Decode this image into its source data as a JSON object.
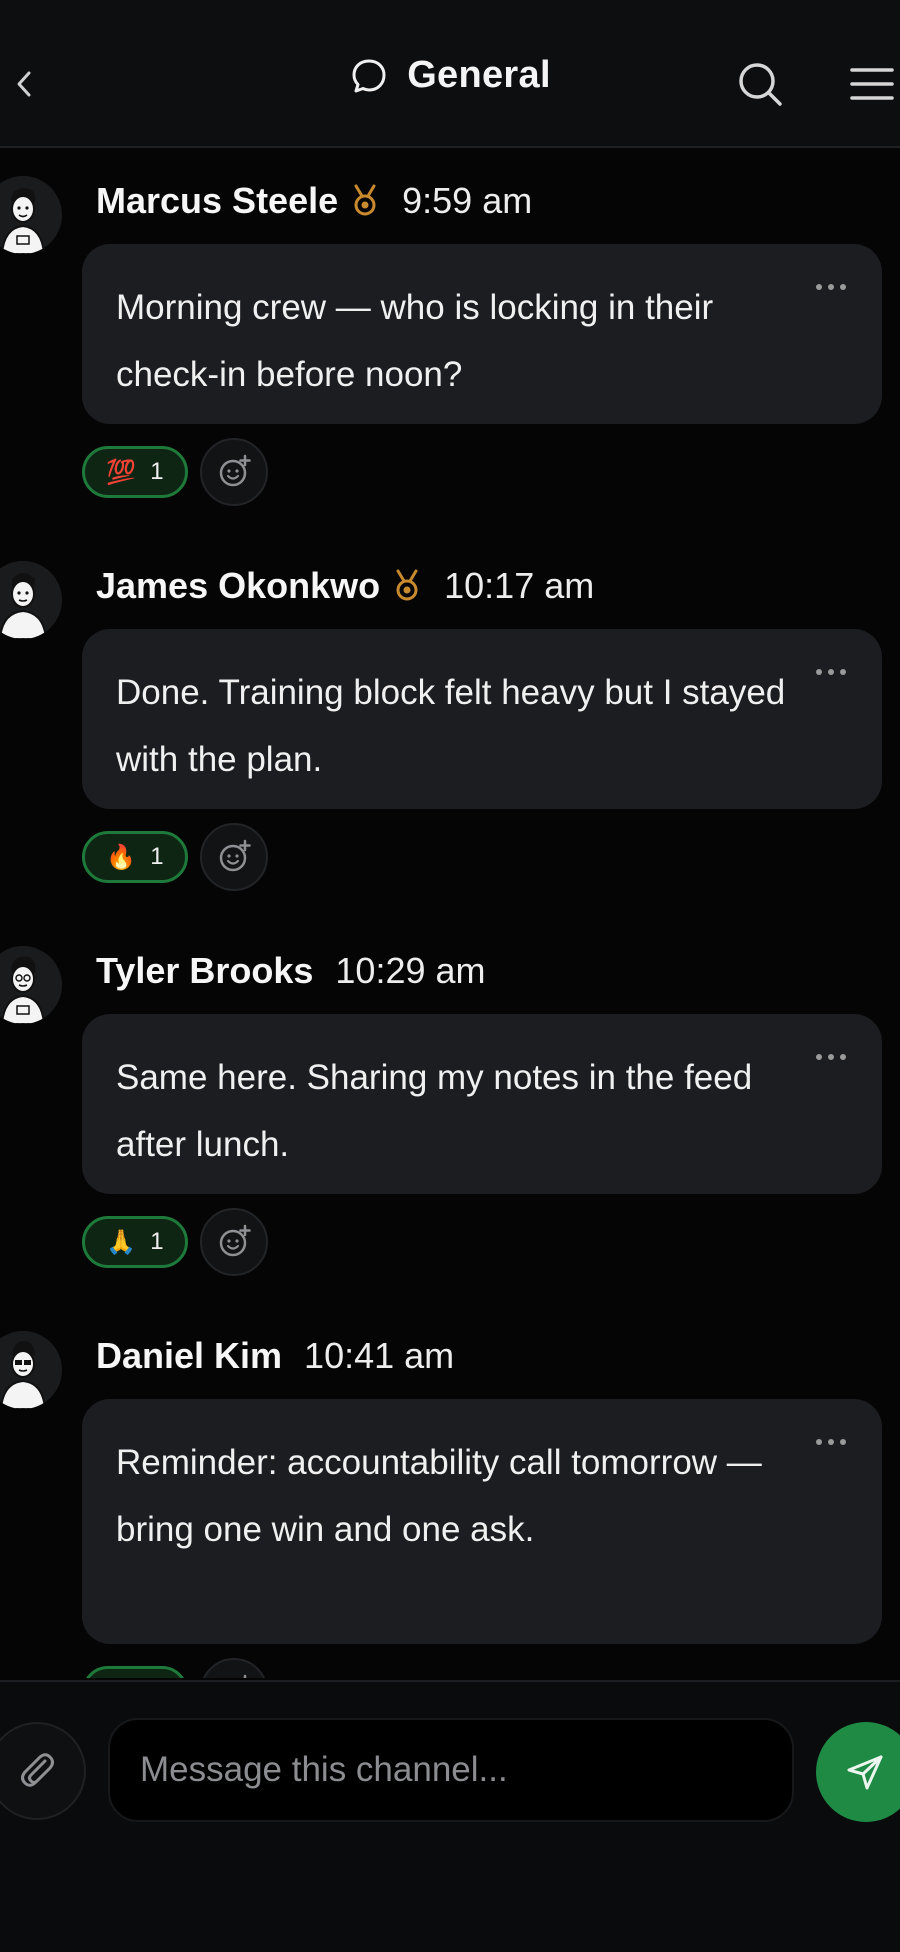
{
  "header": {
    "title": "General",
    "back_icon": "chevron-left-icon",
    "chat_icon": "chat-bubble-icon",
    "search_icon": "search-icon",
    "menu_icon": "menu-icon"
  },
  "messages": [
    {
      "author": "Marcus Steele",
      "has_badge": true,
      "time": "9:59 am",
      "text": "Morning crew — who is locking in their check-in before noon?",
      "reaction": {
        "emoji": "💯",
        "count": "1"
      }
    },
    {
      "author": "James Okonkwo",
      "has_badge": true,
      "time": "10:17 am",
      "text": "Done. Training block felt heavy but I stayed with the plan.",
      "reaction": {
        "emoji": "🔥",
        "count": "1"
      }
    },
    {
      "author": "Tyler Brooks",
      "has_badge": false,
      "time": "10:29 am",
      "text": "Same here. Sharing my notes in the feed after lunch.",
      "reaction": {
        "emoji": "🙏",
        "count": "1"
      }
    },
    {
      "author": "Daniel Kim",
      "has_badge": false,
      "time": "10:41 am",
      "text": "Reminder: accountability call tomorrow — bring one win and one ask.",
      "reaction": {
        "emoji": "",
        "count": ""
      }
    }
  ],
  "composer": {
    "placeholder": "Message this channel...",
    "attach_icon": "paperclip-icon",
    "send_icon": "send-icon"
  },
  "colors": {
    "background": "#050505",
    "bubble": "#1c1d20",
    "accent_green": "#1e8a44",
    "reaction_border": "#1e7a3a",
    "badge_gold": "#c98a2e"
  }
}
